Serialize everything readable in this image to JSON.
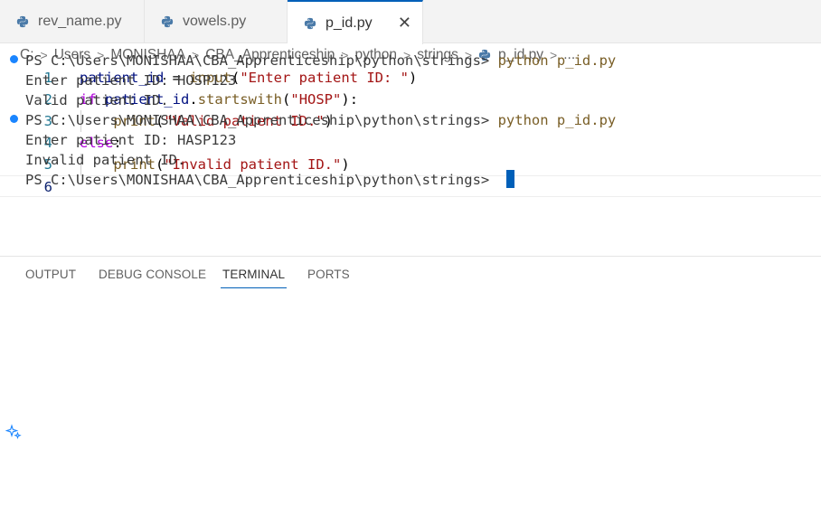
{
  "tabs": [
    {
      "label": "rev_name.py",
      "icon": "python-file-icon"
    },
    {
      "label": "vowels.py",
      "icon": "python-file-icon"
    },
    {
      "label": "p_id.py",
      "icon": "python-file-icon",
      "active": true
    }
  ],
  "tab_close_glyph": "✕",
  "breadcrumb": {
    "items": [
      "C:",
      "Users",
      "MONISHAA",
      "CBA_Apprenticeship",
      "python",
      "strings",
      "p_id.py"
    ],
    "ellipsis": "..."
  },
  "editor": {
    "line_numbers": [
      "1",
      "2",
      "3",
      "4",
      "5",
      "6"
    ],
    "current_line": 6,
    "lines": [
      [
        {
          "t": "patient_id",
          "c": "var"
        },
        {
          "t": " = ",
          "c": "op"
        },
        {
          "t": "input",
          "c": "fn"
        },
        {
          "t": "(",
          "c": "op"
        },
        {
          "t": "\"Enter patient ID: \"",
          "c": "str"
        },
        {
          "t": ")",
          "c": "op"
        }
      ],
      [
        {
          "t": "if",
          "c": "kw"
        },
        {
          "t": " ",
          "c": "op"
        },
        {
          "t": "patient_id",
          "c": "var"
        },
        {
          "t": ".",
          "c": "op"
        },
        {
          "t": "startswith",
          "c": "fn"
        },
        {
          "t": "(",
          "c": "op"
        },
        {
          "t": "\"HOSP\"",
          "c": "str"
        },
        {
          "t": "):",
          "c": "op"
        }
      ],
      [
        {
          "t": "    ",
          "c": "op"
        },
        {
          "t": "print",
          "c": "fn"
        },
        {
          "t": "(",
          "c": "op"
        },
        {
          "t": "\"Valid patient ID.\"",
          "c": "str"
        },
        {
          "t": ")",
          "c": "op"
        }
      ],
      [
        {
          "t": "else",
          "c": "kw"
        },
        {
          "t": ":",
          "c": "op"
        }
      ],
      [
        {
          "t": "    ",
          "c": "op"
        },
        {
          "t": "print",
          "c": "fn"
        },
        {
          "t": "(",
          "c": "op"
        },
        {
          "t": "\"Invalid patient ID.\"",
          "c": "str"
        },
        {
          "t": ")",
          "c": "op"
        }
      ],
      []
    ]
  },
  "panel": {
    "tabs": [
      "OUTPUT",
      "DEBUG CONSOLE",
      "TERMINAL",
      "PORTS"
    ],
    "active_tab": "TERMINAL"
  },
  "terminal": {
    "prompt": "PS C:\\Users\\MONISHAA\\CBA_Apprenticeship\\python\\strings> ",
    "runs": [
      {
        "command": "python p_id.py",
        "output": [
          "Enter patient ID: HOSP123",
          "Valid patient ID."
        ]
      },
      {
        "command": "python p_id.py",
        "output": [
          "Enter patient ID: HASP123",
          "Invalid patient ID."
        ]
      }
    ]
  },
  "colors": {
    "accent": "#005fb8",
    "keyword": "#af00db",
    "function": "#795e26",
    "variable": "#001080",
    "string": "#a31515",
    "line_number": "#237893",
    "success_dot": "#1a85ff"
  }
}
